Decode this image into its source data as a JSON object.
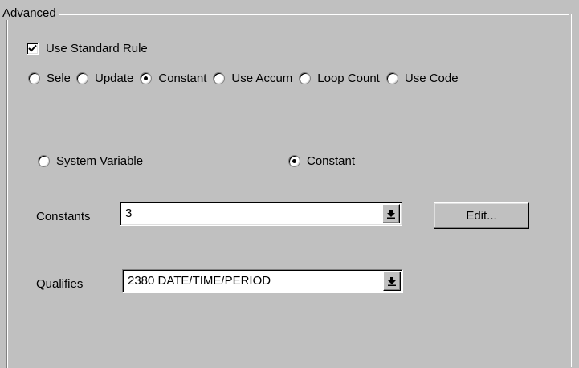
{
  "group": {
    "title": "Advanced"
  },
  "use_standard_rule": {
    "label": "Use Standard Rule",
    "checked": true
  },
  "rule_type": {
    "options": [
      {
        "label": "Select",
        "checked": false
      },
      {
        "label": "Update",
        "checked": false
      },
      {
        "label": "Constant",
        "checked": true
      },
      {
        "label": "Use Accum",
        "checked": false
      },
      {
        "label": "Loop Count",
        "checked": false
      },
      {
        "label": "Use Code",
        "checked": false
      }
    ]
  },
  "source": {
    "system_variable_label": "System Variable",
    "system_variable_checked": false,
    "constant_label": "Constant",
    "constant_checked": true
  },
  "constants": {
    "label": "Constants",
    "value": "3"
  },
  "edit_button": {
    "label": "Edit..."
  },
  "qualifies": {
    "label": "Qualifies",
    "value": "2380 DATE/TIME/PERIOD"
  },
  "icons": {
    "checkbox_mark": "checkmark-icon",
    "dropdown_arrow": "dropdown-arrow-icon"
  }
}
